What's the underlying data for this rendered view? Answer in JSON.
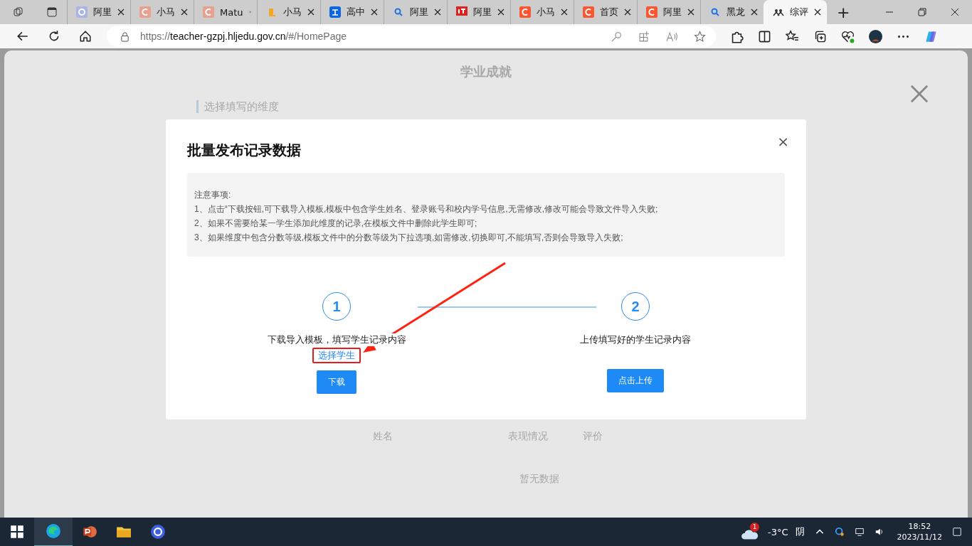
{
  "browser": {
    "tabs": [
      {
        "title": "阿里",
        "kind": "ring",
        "selected": false
      },
      {
        "title": "小马",
        "kind": "c-pale",
        "selected": false
      },
      {
        "title": "Matu",
        "kind": "c-pale",
        "selected": false
      },
      {
        "title": "小马",
        "kind": "book",
        "selected": false
      },
      {
        "title": "高中",
        "kind": "zhi",
        "selected": false
      },
      {
        "title": "阿里",
        "kind": "search",
        "selected": false
      },
      {
        "title": "阿里",
        "kind": "it",
        "selected": false
      },
      {
        "title": "小马",
        "kind": "c",
        "selected": false
      },
      {
        "title": "首页",
        "kind": "c",
        "selected": false
      },
      {
        "title": "阿里",
        "kind": "c",
        "selected": false
      },
      {
        "title": "黑龙",
        "kind": "search",
        "selected": false
      },
      {
        "title": "综评",
        "kind": "people",
        "selected": true
      }
    ],
    "new_tab": "+",
    "address": {
      "scheme": "https://",
      "host": "teacher-gzpj.hljedu.gov.cn",
      "path": "/#/HomePage"
    }
  },
  "page": {
    "title": "学业成就",
    "section": "选择填写的维度",
    "columns": [
      "姓名",
      "表现情况",
      "评价"
    ],
    "empty": "暂无数据"
  },
  "dialog": {
    "title": "批量发布记录数据",
    "close": "×",
    "notes": [
      "注意事项:",
      "1、点击“下载按钮,可下载导入模板,模板中包含学生姓名、登录账号和校内学号信息,无需修改,修改可能会导致文件导入失败;",
      "2、如果不需要给某一学生添加此维度的记录,在模板文件中删除此学生即可;",
      "3、如果维度中包含分数等级,模板文件中的分数等级为下拉选项,如需修改,切换即可,不能填写,否则会导致导入失败;"
    ],
    "steps": [
      {
        "number": "1",
        "text": "下载导入模板，填写学生记录内容",
        "link": "选择学生",
        "button": "下载"
      },
      {
        "number": "2",
        "text": "上传填写好的学生记录内容",
        "button": "点击上传"
      }
    ]
  },
  "taskbar": {
    "weather_badge": "1",
    "temperature": "-3°C",
    "condition": "阴",
    "time": "18:52",
    "date": "2023/11/12"
  }
}
